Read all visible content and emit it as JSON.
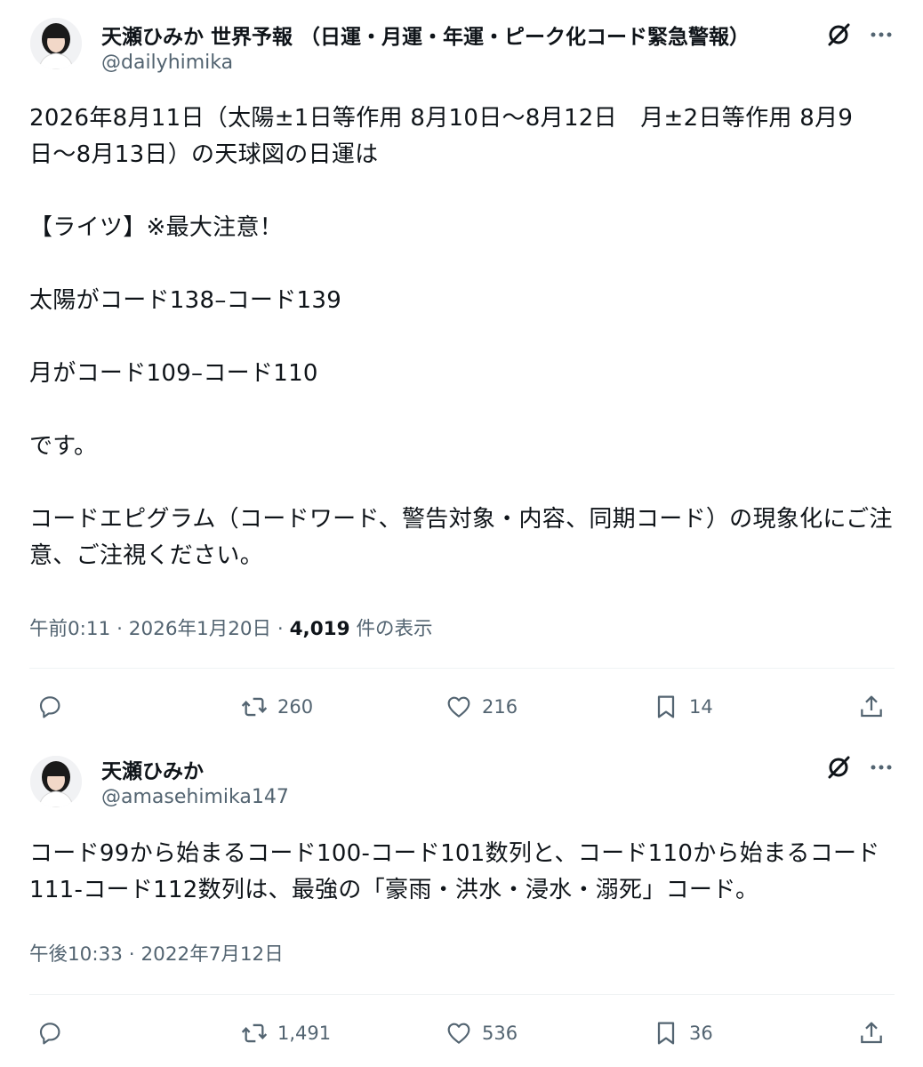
{
  "tweets": [
    {
      "display_name": "天瀬ひみか 世界予報 （日運・月運・年運・ピーク化コード緊急警報）",
      "handle": "@dailyhimika",
      "paragraphs": [
        "2026年8月11日（太陽±1日等作用 8月10日〜8月12日　月±2日等作用 8月9日〜8月13日）の天球図の日運は",
        "【ライツ】※最大注意！",
        "太陽がコード138–コード139",
        "月がコード109–コード110",
        "です。",
        "コードエピグラム（コードワード、警告対象・内容、同期コード）の現象化にご注意、ご注視ください。"
      ],
      "time": "午前0:11",
      "date": "2026年1月20日",
      "views": "4,019",
      "views_label": "件の表示",
      "replies": "",
      "retweets": "260",
      "likes": "216",
      "bookmarks": "14"
    },
    {
      "display_name": "天瀬ひみか",
      "handle": "@amasehimika147",
      "paragraphs": [
        "コード99から始まるコード100-コード101数列と、コード110から始まるコード111-コード112数列は、最強の「豪雨・洪水・浸水・溺死」コード。"
      ],
      "time": "午後10:33",
      "date": "2022年7月12日",
      "replies": "",
      "retweets": "1,491",
      "likes": "536",
      "bookmarks": "36"
    }
  ],
  "separator": " · ",
  "icons": {
    "grok": "grok-slash-icon",
    "more": "more-dots-icon",
    "reply": "reply-bubble-icon",
    "retweet": "retweet-arrows-icon",
    "like": "heart-icon",
    "bookmark": "bookmark-icon",
    "share": "share-upload-icon"
  },
  "colors": {
    "text": "#0f1419",
    "secondary": "#536471",
    "divider": "#eff3f4"
  }
}
